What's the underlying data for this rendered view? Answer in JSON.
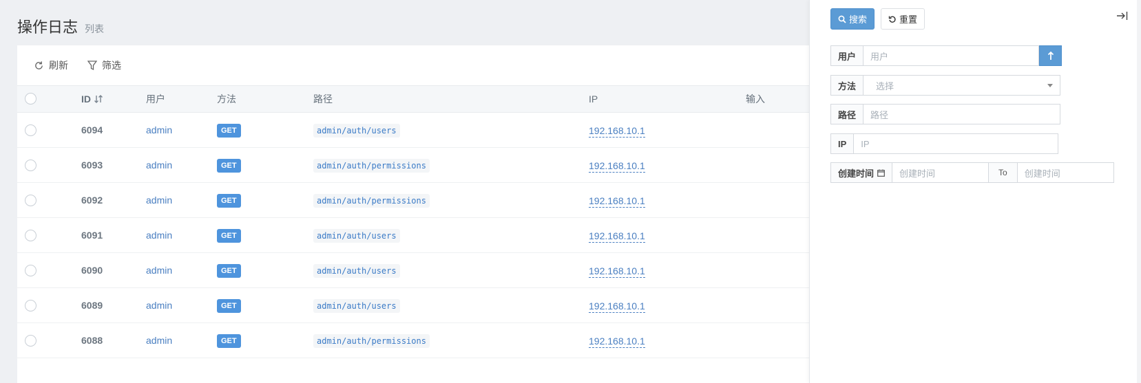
{
  "header": {
    "title": "操作日志",
    "subtitle": "列表"
  },
  "toolbar": {
    "refresh_label": "刷新",
    "filter_label": "筛选"
  },
  "table": {
    "columns": [
      "ID",
      "用户",
      "方法",
      "路径",
      "IP",
      "输入"
    ],
    "rows": [
      {
        "id": "6094",
        "user": "admin",
        "method": "GET",
        "path": "admin/auth/users",
        "ip": "192.168.10.1"
      },
      {
        "id": "6093",
        "user": "admin",
        "method": "GET",
        "path": "admin/auth/permissions",
        "ip": "192.168.10.1"
      },
      {
        "id": "6092",
        "user": "admin",
        "method": "GET",
        "path": "admin/auth/permissions",
        "ip": "192.168.10.1"
      },
      {
        "id": "6091",
        "user": "admin",
        "method": "GET",
        "path": "admin/auth/users",
        "ip": "192.168.10.1"
      },
      {
        "id": "6090",
        "user": "admin",
        "method": "GET",
        "path": "admin/auth/users",
        "ip": "192.168.10.1"
      },
      {
        "id": "6089",
        "user": "admin",
        "method": "GET",
        "path": "admin/auth/users",
        "ip": "192.168.10.1"
      },
      {
        "id": "6088",
        "user": "admin",
        "method": "GET",
        "path": "admin/auth/permissions",
        "ip": "192.168.10.1"
      }
    ]
  },
  "filter": {
    "search_label": "搜索",
    "reset_label": "重置",
    "user": {
      "label": "用户",
      "placeholder": "用户"
    },
    "method": {
      "label": "方法",
      "placeholder": "选择"
    },
    "path": {
      "label": "路径",
      "placeholder": "路径"
    },
    "ip": {
      "label": "IP",
      "placeholder": "IP"
    },
    "created": {
      "label": "创建时间",
      "from_placeholder": "创建时间",
      "to_label": "To",
      "to_placeholder": "创建时间"
    }
  },
  "icons": {
    "refresh": "refresh-icon",
    "filter": "filter-icon",
    "sort": "sort-icon",
    "search": "search-icon",
    "reset": "undo-icon",
    "collapse": "collapse-right-icon",
    "upload": "arrow-up-icon",
    "dropdown": "caret-down-icon",
    "calendar": "calendar-icon"
  },
  "colors": {
    "primary": "#5b9bd5",
    "link": "#4a7fc1",
    "method_badge": "#4e94dd"
  }
}
